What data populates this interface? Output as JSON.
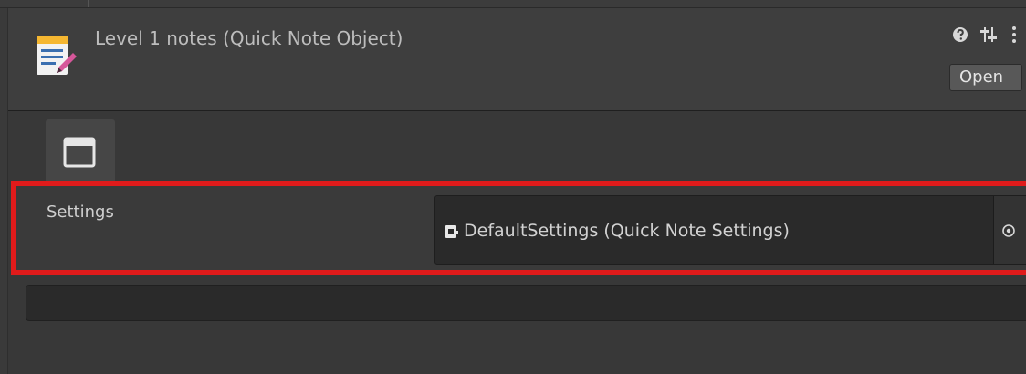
{
  "header": {
    "title": "Level 1 notes (Quick Note Object)",
    "open_label": "Open",
    "icons": [
      "note-icon",
      "help-icon",
      "preset-icon",
      "menu-icon"
    ]
  },
  "tabs": [
    {
      "icon": "window-view-icon",
      "selected": true
    }
  ],
  "settings": {
    "label": "Settings",
    "value": "DefaultSettings (Quick Note Settings)",
    "value_icon": "scriptable-object-icon",
    "picker_icon": "object-picker-icon"
  },
  "note_text": {
    "value": ""
  },
  "colors": {
    "background": "#383838",
    "header": "#3e3e3e",
    "field": "#2a2a2a",
    "highlight": "#e01b1b",
    "text": "#cfcfcf"
  }
}
